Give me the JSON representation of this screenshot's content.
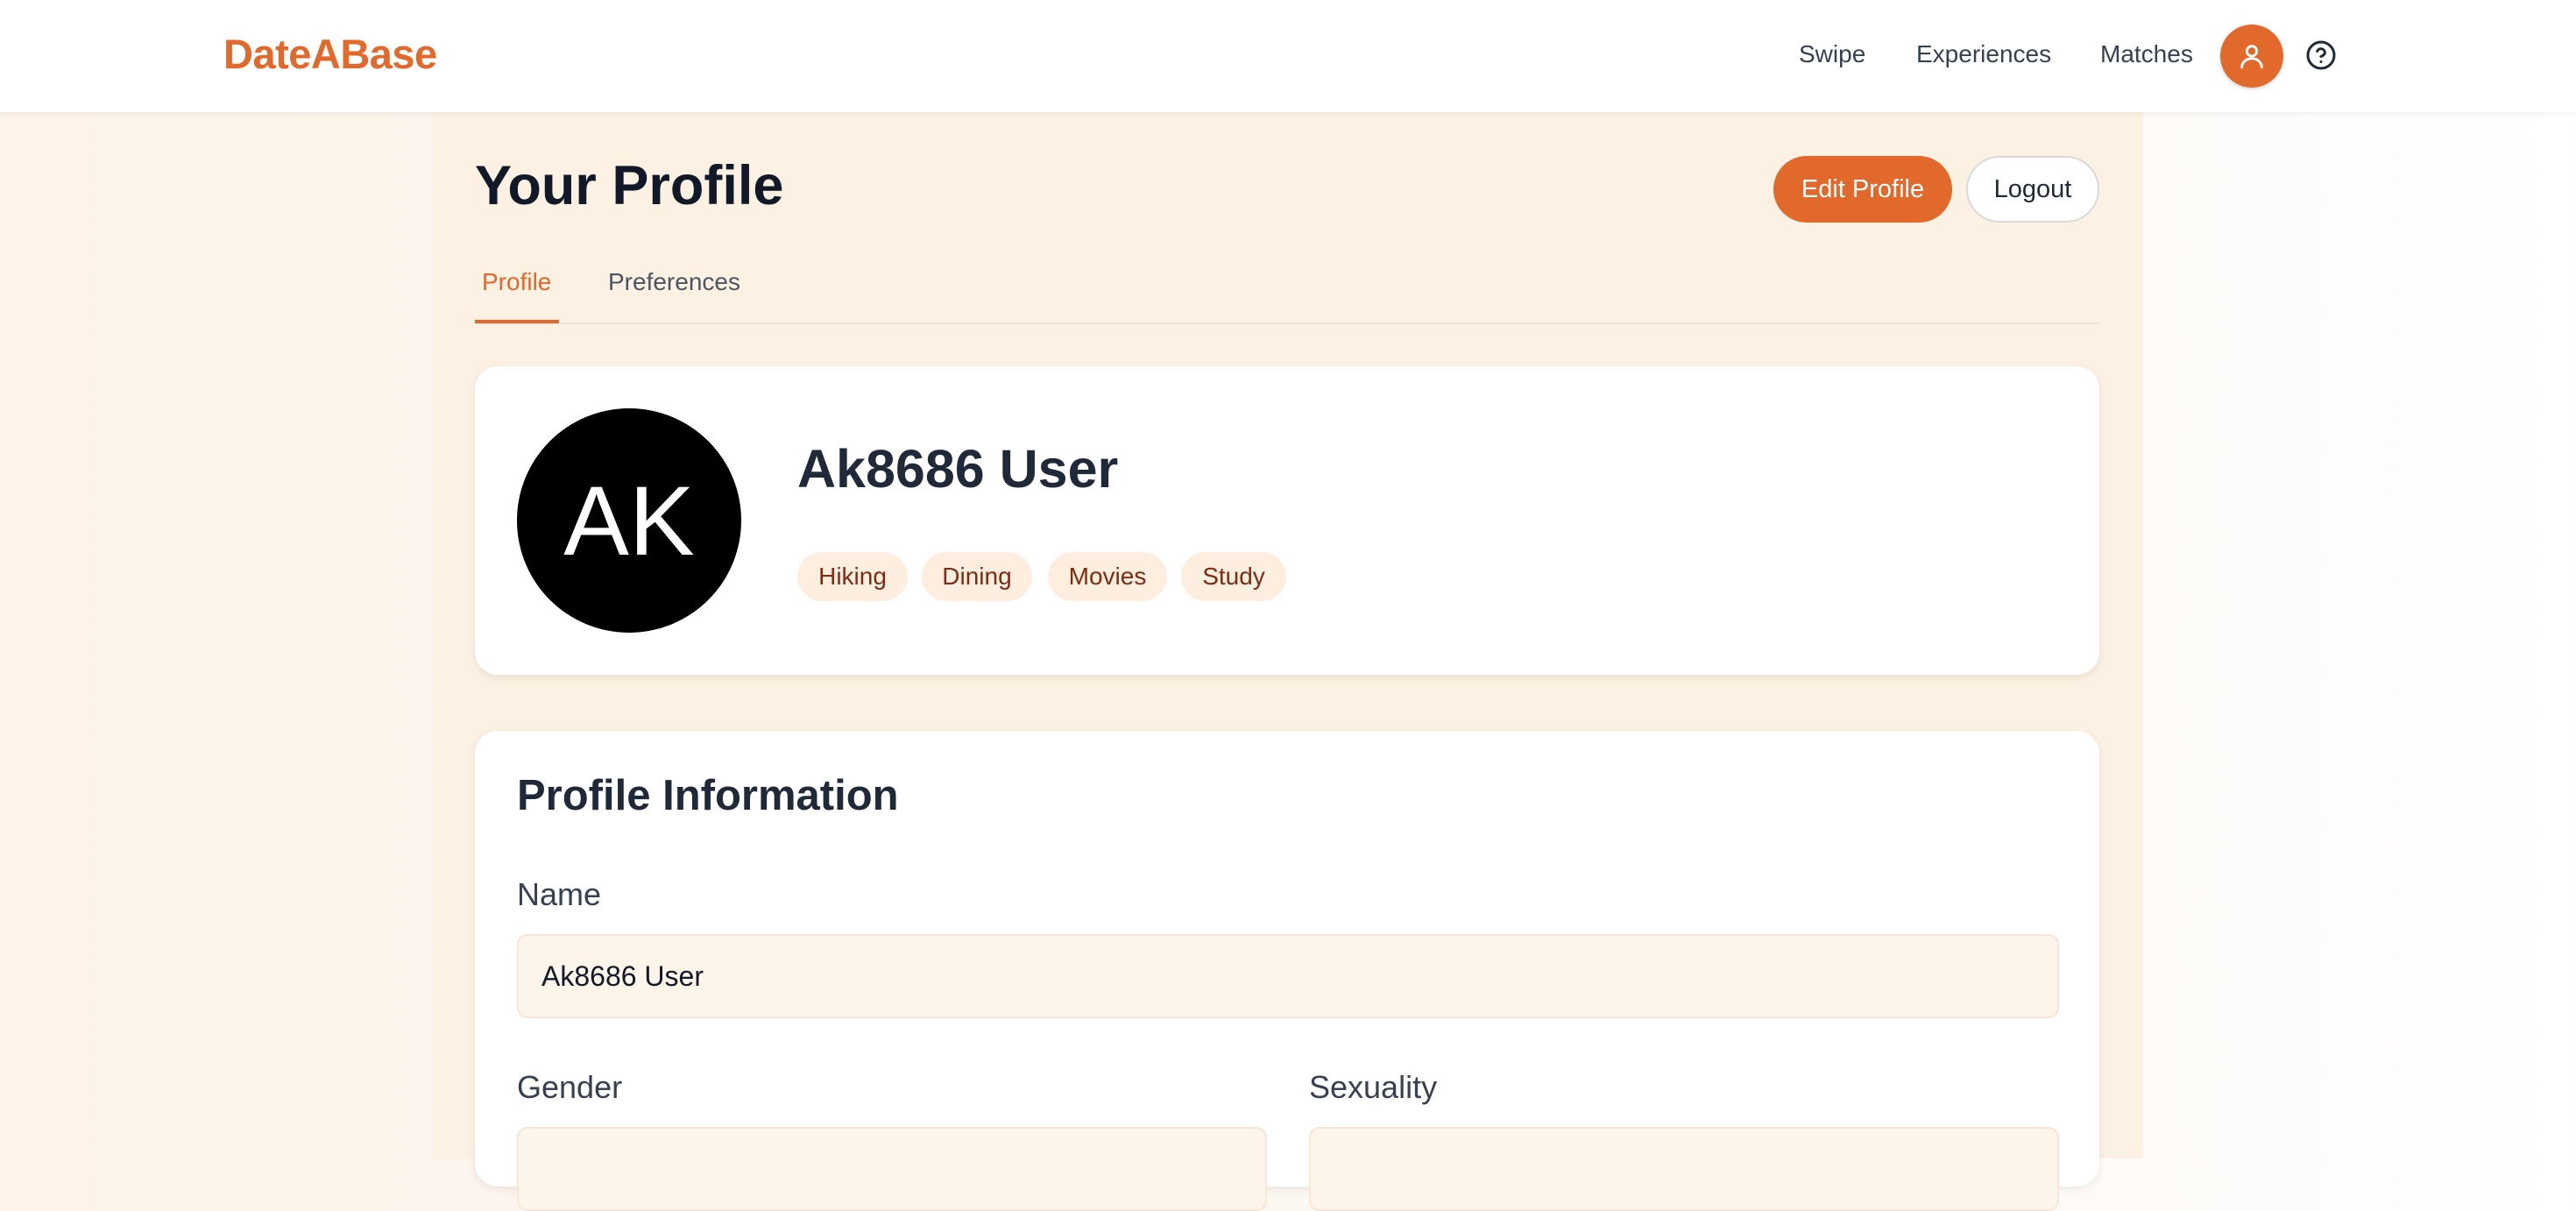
{
  "brand": "DateABase",
  "nav": {
    "links": [
      "Swipe",
      "Experiences",
      "Matches"
    ],
    "profile_icon": "user-icon",
    "help_icon": "help-circle-icon"
  },
  "page": {
    "title": "Your Profile",
    "edit_button": "Edit Profile",
    "logout_button": "Logout",
    "tabs": [
      {
        "label": "Profile",
        "active": true
      },
      {
        "label": "Preferences",
        "active": false
      }
    ]
  },
  "profile_card": {
    "initials": "AK",
    "name": "Ak8686 User",
    "interests": [
      "Hiking",
      "Dining",
      "Movies",
      "Study"
    ]
  },
  "info_section": {
    "title": "Profile Information",
    "name_label": "Name",
    "name_value": "Ak8686 User",
    "gender_label": "Gender",
    "gender_value": "",
    "sexuality_label": "Sexuality",
    "sexuality_value": ""
  },
  "colors": {
    "accent": "#e0692b",
    "chip_bg": "#fdeedf",
    "chip_text": "#7c2d12",
    "column_bg": "#fdf1e3",
    "input_bg": "#fdf4ea"
  }
}
